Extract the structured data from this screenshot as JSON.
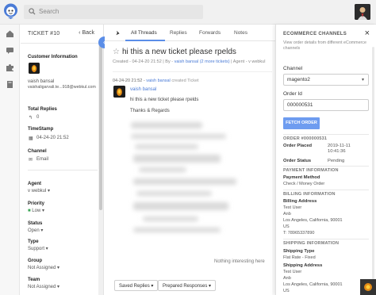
{
  "search": {
    "placeholder": "Search"
  },
  "ticket": {
    "id_label": "TICKET #10",
    "back_label": "Back",
    "customer_info_label": "Customer Information",
    "customer_name": "vaish bansal",
    "customer_email": "vaishaligarvali.te...918@webkul.com",
    "total_replies_label": "Total Replies",
    "total_replies": "0",
    "timestamp_label": "TimeStamp",
    "timestamp": "04-24-20 21:52",
    "channel_label": "Channel",
    "channel": "Email",
    "agent_label": "Agent",
    "agent": "v webkul",
    "priority_label": "Priority",
    "priority": "Low",
    "status_label": "Status",
    "status": "Open",
    "type_label": "Type",
    "type": "Support",
    "group_label": "Group",
    "group": "Not Assigned",
    "team_label": "Team",
    "team": "Not Assigned"
  },
  "tabs": [
    "All Threads",
    "Replies",
    "Forwards",
    "Notes"
  ],
  "thread": {
    "subject": "hi this a new ticket please rpelds",
    "meta_created": "Created",
    "meta_date": "04-24-20 21:52",
    "meta_by": "By",
    "meta_name": "vaish bansal",
    "meta_replies": "(2 more tickets)",
    "meta_agent": "Agent",
    "meta_agent_value": "v webkul",
    "entry_time": "04-24-20 21:52",
    "entry_author": "vaish bansal",
    "entry_action": "created Ticket",
    "entry_name": "vaish bansal",
    "entry_line1": "hi this a new ticket please rpelds",
    "entry_line2": "Thanks & Regards",
    "nothing_label": "Nothing interesting here"
  },
  "bottom_buttons": [
    "Saved Replies",
    "Prepared Responses"
  ],
  "side": {
    "title": "ECOMMERCE CHANNELS",
    "close": "×",
    "description": "View order details from different eCommerce channels",
    "channel_label": "Channel",
    "channel_value": "magento2",
    "order_id_label": "Order Id",
    "order_id_value": "000000531",
    "fetch_label": "FETCH ORDER",
    "order_heading": "ORDER #000000531",
    "order_placed_label": "Order Placed",
    "order_placed_date": "2019-11-11",
    "order_placed_time": "10:41:36",
    "order_status_label": "Order Status",
    "order_status": "Pending",
    "payment_heading": "PAYMENT INFORMATION",
    "payment_method_label": "Payment Method",
    "payment_method": "Check / Money Order",
    "billing_heading": "BILLING INFORMATION",
    "billing_address_label": "Billing Address",
    "billing_lines": [
      "Test User",
      "Anb",
      "Los Angeles, California, 90001",
      "US",
      "T: 78965337890"
    ],
    "shipping_heading": "SHIPPING INFORMATION",
    "shipping_type_label": "Shipping Type",
    "shipping_type": "Flat Rate - Fixed",
    "shipping_address_label": "Shipping Address",
    "shipping_lines": [
      "Test User",
      "Anb",
      "Los Angeles, California, 90001",
      "US"
    ]
  },
  "colors": {
    "accent": "#5b8ee8",
    "fetch_button": "#6e9cf0",
    "priority_low": "#3aa655"
  }
}
